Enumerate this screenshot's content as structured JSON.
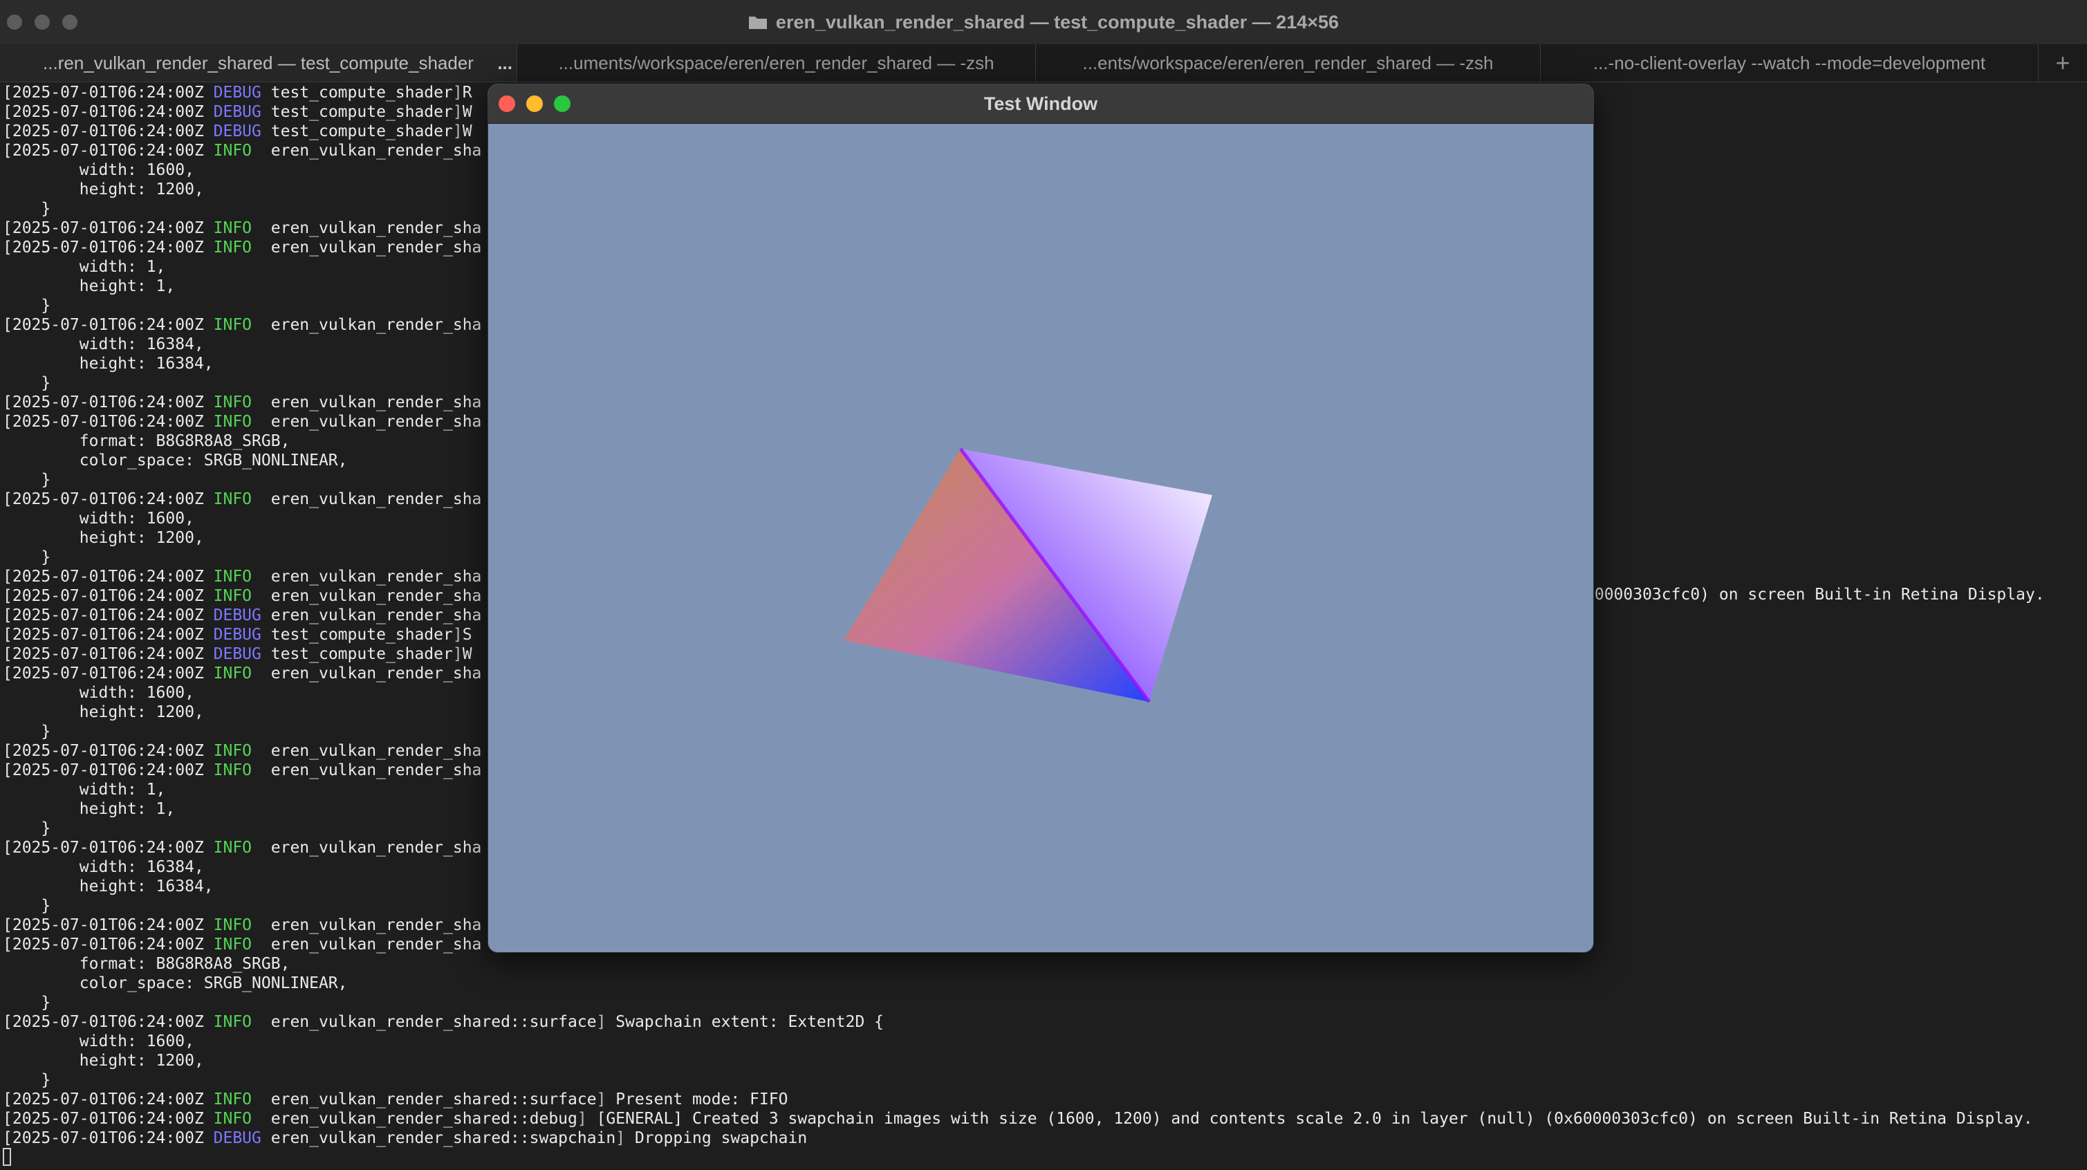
{
  "terminal": {
    "window_title": "eren_vulkan_render_shared — test_compute_shader — 214×56",
    "tabs": [
      {
        "label": "...ren_vulkan_render_shared — test_compute_shader",
        "more": "..."
      },
      {
        "label": "...uments/workspace/eren/eren_render_shared — -zsh"
      },
      {
        "label": "...ents/workspace/eren/eren_render_shared — -zsh"
      },
      {
        "label": "...-no-client-overlay --watch --mode=development"
      }
    ],
    "new_tab_label": "+",
    "lines": [
      {
        "ts": "[2025-07-01T06:24:00Z ",
        "level": "DEBUG",
        "mod": "test_compute_shader",
        "rest": "R"
      },
      {
        "ts": "[2025-07-01T06:24:00Z ",
        "level": "DEBUG",
        "mod": "test_compute_shader",
        "rest": "W"
      },
      {
        "ts": "[2025-07-01T06:24:00Z ",
        "level": "DEBUG",
        "mod": "test_compute_shader",
        "rest": "W"
      },
      {
        "ts": "[2025-07-01T06:24:00Z ",
        "level": "INFO ",
        "mod": "eren_vulkan_render_sha",
        "rest": ""
      },
      {
        "plain": "        width: 1600,"
      },
      {
        "plain": "        height: 1200,"
      },
      {
        "plain": "    }"
      },
      {
        "ts": "[2025-07-01T06:24:00Z ",
        "level": "INFO ",
        "mod": "eren_vulkan_render_sha",
        "rest": ""
      },
      {
        "ts": "[2025-07-01T06:24:00Z ",
        "level": "INFO ",
        "mod": "eren_vulkan_render_sha",
        "rest": ""
      },
      {
        "plain": "        width: 1,"
      },
      {
        "plain": "        height: 1,"
      },
      {
        "plain": "    }"
      },
      {
        "ts": "[2025-07-01T06:24:00Z ",
        "level": "INFO ",
        "mod": "eren_vulkan_render_sha",
        "rest": ""
      },
      {
        "plain": "        width: 16384,"
      },
      {
        "plain": "        height: 16384,"
      },
      {
        "plain": "    }"
      },
      {
        "ts": "[2025-07-01T06:24:00Z ",
        "level": "INFO ",
        "mod": "eren_vulkan_render_sha",
        "rest": ""
      },
      {
        "ts": "[2025-07-01T06:24:00Z ",
        "level": "INFO ",
        "mod": "eren_vulkan_render_sha",
        "rest": ""
      },
      {
        "plain": "        format: B8G8R8A8_SRGB,"
      },
      {
        "plain": "        color_space: SRGB_NONLINEAR,"
      },
      {
        "plain": "    }"
      },
      {
        "ts": "[2025-07-01T06:24:00Z ",
        "level": "INFO ",
        "mod": "eren_vulkan_render_sha",
        "rest": ""
      },
      {
        "plain": "        width: 1600,"
      },
      {
        "plain": "        height: 1200,"
      },
      {
        "plain": "    }"
      },
      {
        "ts": "[2025-07-01T06:24:00Z ",
        "level": "INFO ",
        "mod": "eren_vulkan_render_sha",
        "rest": ""
      },
      {
        "ts": "[2025-07-01T06:24:00Z ",
        "level": "INFO ",
        "mod": "eren_vulkan_render_sha",
        "rest": ""
      },
      {
        "ts": "[2025-07-01T06:24:00Z ",
        "level": "DEBUG",
        "mod": "eren_vulkan_render_sha",
        "rest": ""
      },
      {
        "ts": "[2025-07-01T06:24:00Z ",
        "level": "DEBUG",
        "mod": "test_compute_shader",
        "rest": "S"
      },
      {
        "ts": "[2025-07-01T06:24:00Z ",
        "level": "DEBUG",
        "mod": "test_compute_shader",
        "rest": "W"
      },
      {
        "ts": "[2025-07-01T06:24:00Z ",
        "level": "INFO ",
        "mod": "eren_vulkan_render_sha",
        "rest": ""
      },
      {
        "plain": "        width: 1600,"
      },
      {
        "plain": "        height: 1200,"
      },
      {
        "plain": "    }"
      },
      {
        "ts": "[2025-07-01T06:24:00Z ",
        "level": "INFO ",
        "mod": "eren_vulkan_render_sha",
        "rest": ""
      },
      {
        "ts": "[2025-07-01T06:24:00Z ",
        "level": "INFO ",
        "mod": "eren_vulkan_render_sha",
        "rest": ""
      },
      {
        "plain": "        width: 1,"
      },
      {
        "plain": "        height: 1,"
      },
      {
        "plain": "    }"
      },
      {
        "ts": "[2025-07-01T06:24:00Z ",
        "level": "INFO ",
        "mod": "eren_vulkan_render_sha",
        "rest": ""
      },
      {
        "plain": "        width: 16384,"
      },
      {
        "plain": "        height: 16384,"
      },
      {
        "plain": "    }"
      },
      {
        "ts": "[2025-07-01T06:24:00Z ",
        "level": "INFO ",
        "mod": "eren_vulkan_render_sha",
        "rest": ""
      },
      {
        "ts": "[2025-07-01T06:24:00Z ",
        "level": "INFO ",
        "mod": "eren_vulkan_render_sha",
        "rest": ""
      },
      {
        "plain": "        format: B8G8R8A8_SRGB,"
      },
      {
        "plain": "        color_space: SRGB_NONLINEAR,"
      },
      {
        "plain": "    }"
      },
      {
        "ts": "[2025-07-01T06:24:00Z ",
        "level": "INFO ",
        "mod": "eren_vulkan_render_shared::surface",
        "rest": " Swapchain extent: Extent2D {"
      },
      {
        "plain": "        width: 1600,"
      },
      {
        "plain": "        height: 1200,"
      },
      {
        "plain": "    }"
      },
      {
        "ts": "[2025-07-01T06:24:00Z ",
        "level": "INFO ",
        "mod": "eren_vulkan_render_shared::surface",
        "rest": " Present mode: FIFO"
      },
      {
        "ts": "[2025-07-01T06:24:00Z ",
        "level": "INFO ",
        "mod": "eren_vulkan_render_shared::debug",
        "rest": " [GENERAL] Created 3 swapchain images with size (1600, 1200) and contents scale 2.0 in layer (null) (0x60000303cfc0) on screen Built-in Retina Display."
      },
      {
        "ts": "[2025-07-01T06:24:00Z ",
        "level": "DEBUG",
        "mod": "eren_vulkan_render_shared::swapchain",
        "rest": " Dropping swapchain"
      }
    ],
    "overflow_fragment": "60000303cfc0) on screen Built-in Retina Display."
  },
  "test_window": {
    "title": "Test Window",
    "clear_color": "#7f94b5",
    "quad_colors": {
      "left": "#7dff4a",
      "top": "#ff2a55",
      "right": "#ffffff",
      "bottom": "#1e14ff"
    }
  }
}
